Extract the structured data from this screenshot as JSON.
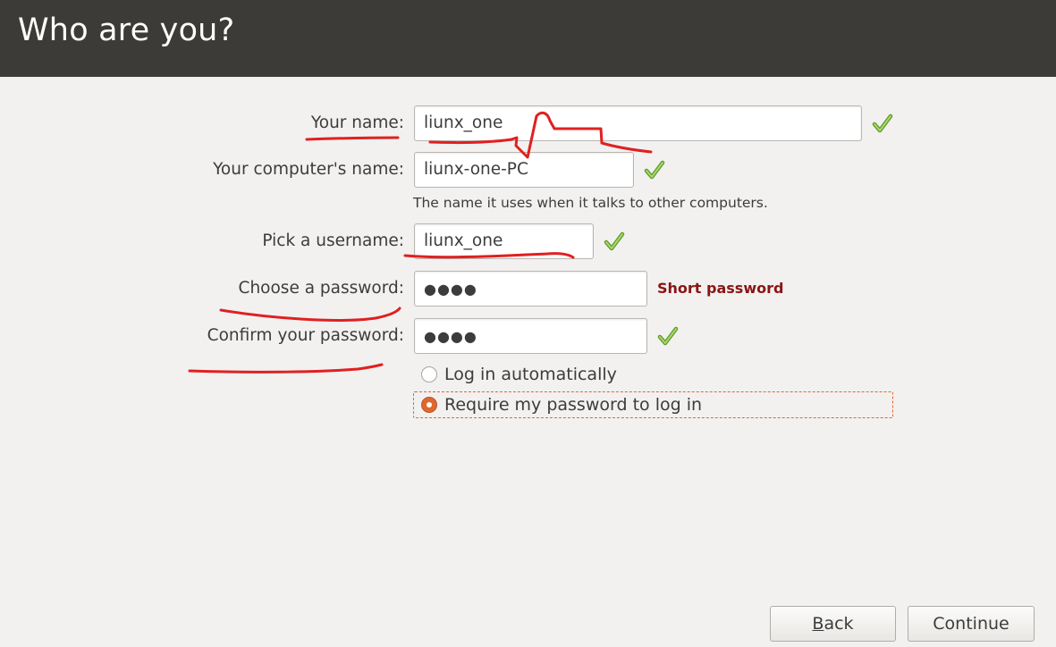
{
  "header": {
    "title": "Who are you?"
  },
  "form": {
    "your_name": {
      "label": "Your name:",
      "value": "liunx_one"
    },
    "computer_name": {
      "label": "Your computer's name:",
      "value": "liunx-one-PC",
      "hint": "The name it uses when it talks to other computers."
    },
    "username": {
      "label": "Pick a username:",
      "value": "liunx_one"
    },
    "password": {
      "label": "Choose a password:",
      "value": "●●●●",
      "strength": "Short password"
    },
    "confirm_password": {
      "label": "Confirm your password:",
      "value": "●●●●"
    }
  },
  "login_options": {
    "auto": {
      "label": "Log in automatically",
      "selected": false
    },
    "require_password": {
      "label": "Require my password to log in",
      "selected": true
    }
  },
  "buttons": {
    "back_mnemonic": "B",
    "back_rest": "ack",
    "continue": "Continue"
  },
  "icons": {
    "valid": "check-icon"
  },
  "colors": {
    "header_bg": "#3c3b37",
    "background": "#f2f1f0",
    "accent": "#e0682e",
    "check": "#7cb342",
    "warning": "#8a1515",
    "annotation": "#e02020"
  }
}
